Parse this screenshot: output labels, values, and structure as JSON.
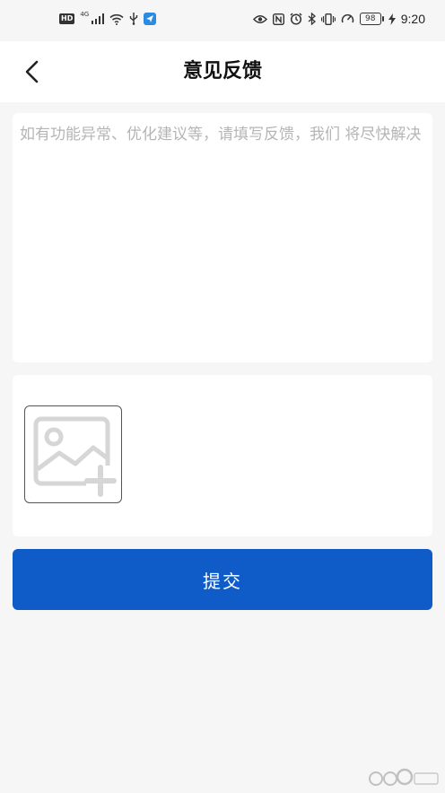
{
  "status_bar": {
    "hd_label": "HD",
    "network_label": "4G",
    "battery_level": "98",
    "time": "9:20",
    "icons": [
      "signal-icon",
      "wifi-icon",
      "usb-icon",
      "app-notification-icon",
      "eye-icon",
      "nfc-icon",
      "alarm-icon",
      "bluetooth-icon",
      "vibrate-icon",
      "data-saver-icon",
      "battery-icon",
      "charging-icon"
    ]
  },
  "nav": {
    "title": "意见反馈",
    "back_icon": "chevron-left-icon"
  },
  "feedback": {
    "value": "",
    "placeholder": "如有功能异常、优化建议等，请填写反馈，我们 将尽快解决"
  },
  "images": {
    "add_icon": "image-add-icon"
  },
  "submit": {
    "label": "提交"
  },
  "colors": {
    "primary": "#0f5cc8",
    "background": "#f6f6f6",
    "card": "#ffffff",
    "placeholder": "#b5b5b5"
  }
}
